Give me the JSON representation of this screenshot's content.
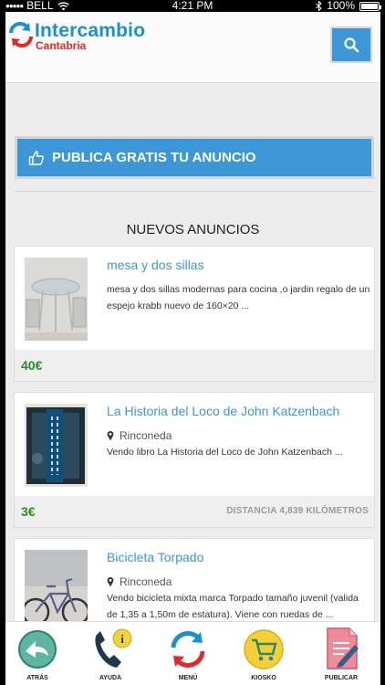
{
  "status_bar": {
    "carrier": "BELL",
    "time": "4:21 PM",
    "battery": "100%",
    "battery_level": 1.0
  },
  "header": {
    "logo_word": "Intercambio",
    "logo_sub": "Cantabria",
    "search_icon": "search-icon"
  },
  "publish_button": {
    "label": "PUBLICA GRATIS TU ANUNCIO",
    "icon": "thumbs-up-icon"
  },
  "section_title": "NUEVOS ANUNCIOS",
  "listings": [
    {
      "title": "mesa y dos sillas",
      "location": "",
      "description": "mesa y dos sillas modernas para cocina ,o jardin regalo de un espejo krabb nuevo de 160×20 ...",
      "price": "40€",
      "distance": ""
    },
    {
      "title": "La Historia del Loco de John Katzenbach",
      "location": "Rinconeda",
      "description": "Vendo libro La Historia del Loco de John Katzenbach ...",
      "price": "3€",
      "distance": "DISTANCIA 4,839 KILÓMETROS"
    },
    {
      "title": "Bicicleta Torpado",
      "location": "Rinconeda",
      "description": "Vendo bicicleta mixta marca Torpado tamaño juvenil (valida de 1,35 a 1,50m de estatura). Viene con ruedas de ...",
      "price": "",
      "distance": ""
    }
  ],
  "tabbar": [
    {
      "label": "ATRÁS",
      "icon": "back-arrow-icon"
    },
    {
      "label": "AYUDA",
      "icon": "help-phone-icon"
    },
    {
      "label": "MENÚ",
      "icon": "menu-arrows-icon"
    },
    {
      "label": "KIOSKO",
      "icon": "shopping-cart-icon"
    },
    {
      "label": "PUBLICAR",
      "icon": "publish-document-icon"
    }
  ],
  "colors": {
    "accent": "#3d96d6",
    "price_green": "#2a8a2a",
    "logo_red": "#e02a2a"
  }
}
